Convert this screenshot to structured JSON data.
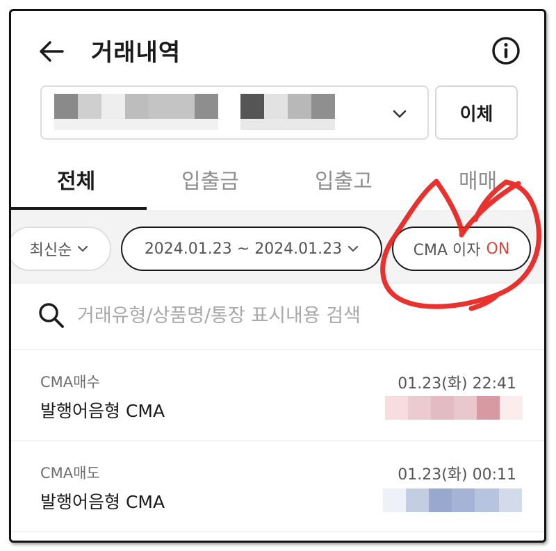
{
  "header": {
    "title": "거래내역",
    "back_icon": "arrow-left-icon",
    "info_icon": "info-icon"
  },
  "account": {
    "masked": true,
    "dropdown_icon": "chevron-down-icon"
  },
  "transfer_button": {
    "label": "이체"
  },
  "tabs": [
    {
      "label": "전체",
      "active": true
    },
    {
      "label": "입출금",
      "active": false
    },
    {
      "label": "입출고",
      "active": false
    },
    {
      "label": "매매",
      "active": false
    }
  ],
  "filters": {
    "sort": {
      "label": "최신순"
    },
    "date_range": {
      "label": "2024.01.23 ~ 2024.01.23"
    },
    "cma_interest": {
      "label": "CMA 이자",
      "state": "ON"
    }
  },
  "search": {
    "placeholder": "거래유형/상품명/통장 표시내용 검색",
    "value": ""
  },
  "transactions": [
    {
      "type": "CMA매수",
      "name": "발행어음형 CMA",
      "time": "01.23(화) 22:41",
      "amount_masked": true
    },
    {
      "type": "CMA매도",
      "name": "발행어음형 CMA",
      "time": "01.23(화) 00:11",
      "amount_masked": true
    }
  ],
  "colors": {
    "text_primary": "#1a1a1a",
    "text_muted": "#8e8e8e",
    "on_accent": "#d9453a",
    "annotation_red": "#e8201c",
    "filter_band_bg": "#f3f3f4"
  }
}
